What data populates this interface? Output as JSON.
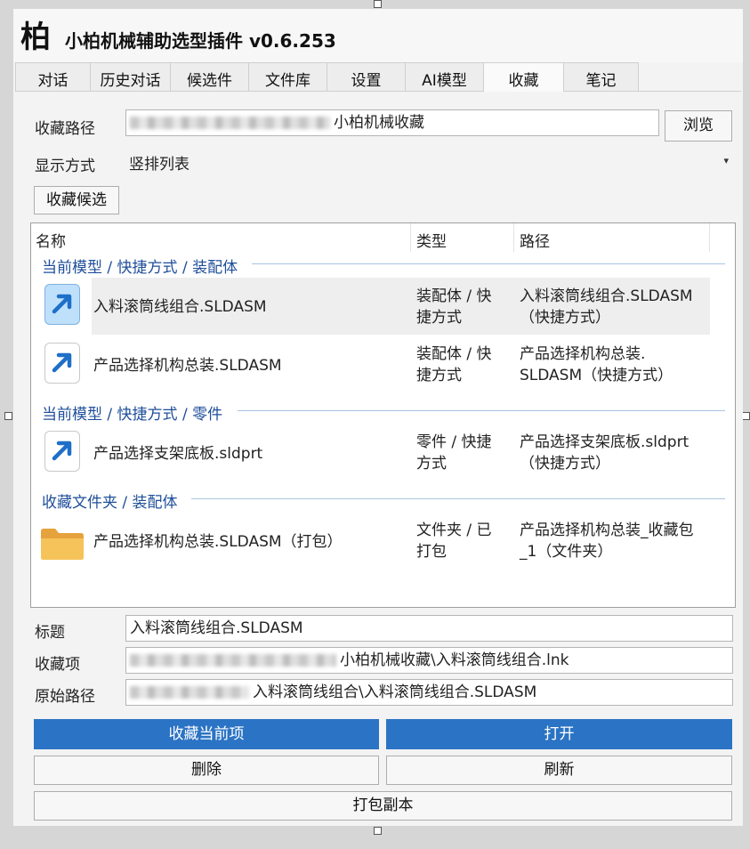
{
  "app": {
    "logo_char": "柏",
    "title": "小柏机械辅助选型插件 v0.6.253"
  },
  "tabs": [
    "对话",
    "历史对话",
    "候选件",
    "文件库",
    "设置",
    "AI模型",
    "收藏",
    "笔记"
  ],
  "active_tab": "收藏",
  "path_row": {
    "label": "收藏路径",
    "value_suffix": "小柏机械收藏",
    "browse_button": "浏览"
  },
  "display_row": {
    "label": "显示方式",
    "selected": "竖排列表"
  },
  "favorite_candidates_button": "收藏候选",
  "list": {
    "columns": [
      "名称",
      "类型",
      "路径"
    ],
    "groups": [
      {
        "title": "当前模型 / 快捷方式 / 装配体",
        "items": [
          {
            "icon": "shortcut-arrow-icon",
            "name": "入料滚筒线组合.SLDASM",
            "type_lines": [
              "装配体 / 快",
              "捷方式"
            ],
            "path_lines": [
              "入料滚筒线组合.SLDASM",
              "（快捷方式）"
            ],
            "selected": true
          },
          {
            "icon": "shortcut-arrow-icon",
            "name": "产品选择机构总装.SLDASM",
            "type_lines": [
              "装配体 / 快",
              "捷方式"
            ],
            "path_lines": [
              "产品选择机构总装.",
              "SLDASM（快捷方式）"
            ],
            "selected": false
          }
        ]
      },
      {
        "title": "当前模型 / 快捷方式 / 零件",
        "items": [
          {
            "icon": "shortcut-arrow-icon",
            "name": "产品选择支架底板.sldprt",
            "type_lines": [
              "零件 / 快捷",
              "方式"
            ],
            "path_lines": [
              "产品选择支架底板.sldprt",
              "（快捷方式）"
            ],
            "selected": false
          }
        ]
      },
      {
        "title": "收藏文件夹 / 装配体",
        "items": [
          {
            "icon": "folder-icon",
            "name": "产品选择机构总装.SLDASM（打包）",
            "type_lines": [
              "文件夹 / 已",
              "打包"
            ],
            "path_lines": [
              "产品选择机构总装_收藏包",
              "_1（文件夹）"
            ],
            "selected": false
          }
        ]
      }
    ]
  },
  "details": {
    "title_label": "标题",
    "title_value": "入料滚筒线组合.SLDASM",
    "item_label": "收藏项",
    "item_value_suffix": "小柏机械收藏\\入料滚筒线组合.lnk",
    "origin_label": "原始路径",
    "origin_value_suffix": "入料滚筒线组合\\入料滚筒线组合.SLDASM"
  },
  "buttons": {
    "favorite_current": "收藏当前项",
    "open": "打开",
    "delete": "删除",
    "refresh": "刷新",
    "pack_copy": "打包副本"
  },
  "colors": {
    "accent": "#2b73c4",
    "group_text": "#1f4e9a",
    "selected_icon_bg": "#bfe0fb"
  }
}
